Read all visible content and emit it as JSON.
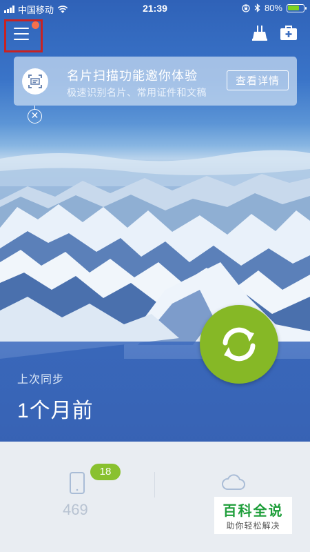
{
  "status_bar": {
    "carrier": "中国移动",
    "time": "21:39",
    "battery_percent": "80%",
    "battery_level": 0.8,
    "battery_color": "#7ed321"
  },
  "top_bar": {
    "menu_icon": "hamburger-menu-icon",
    "notification_dot_color": "#f5704c",
    "right_icons": [
      "sweep-icon",
      "toolbox-icon"
    ]
  },
  "banner": {
    "icon": "card-scan-icon",
    "title": "名片扫描功能邀你体验",
    "subtitle": "极速识别名片、常用证件和文稿",
    "details_label": "查看详情",
    "close_icon": "close-icon"
  },
  "sync": {
    "label": "上次同步",
    "value": "1个月前",
    "button_icon": "sync-arrows-icon",
    "button_color": "#86b826"
  },
  "stats": {
    "contacts_badge": "18",
    "contacts_count": "469",
    "contacts_icon": "phone-icon",
    "cloud_icon": "cloud-icon"
  },
  "watermark": {
    "main": "百科全说",
    "sub": "助你轻松解决"
  }
}
